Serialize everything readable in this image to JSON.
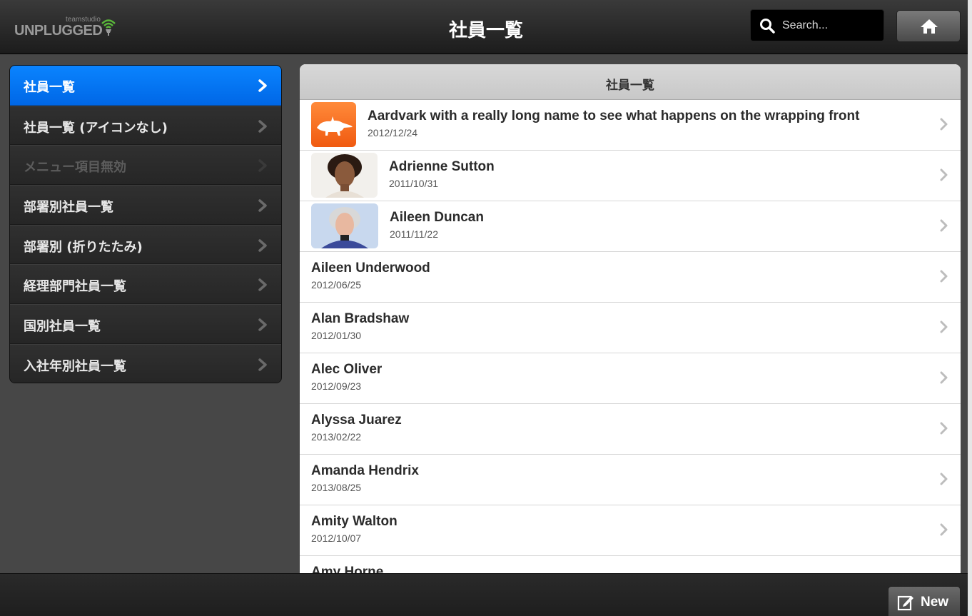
{
  "header": {
    "logo_small": "teamstudio",
    "logo_main": "UNPLUGGED",
    "title": "社員一覧",
    "search_placeholder": "Search..."
  },
  "sidebar": {
    "items": [
      {
        "label": "社員一覧",
        "state": "active"
      },
      {
        "label": "社員一覧 (アイコンなし)",
        "state": "normal"
      },
      {
        "label": "メニュー項目無効",
        "state": "disabled"
      },
      {
        "label": "部署別社員一覧",
        "state": "normal"
      },
      {
        "label": "部署別 (折りたたみ)",
        "state": "normal"
      },
      {
        "label": "経理部門社員一覧",
        "state": "normal"
      },
      {
        "label": "国別社員一覧",
        "state": "normal"
      },
      {
        "label": "入社年別社員一覧",
        "state": "normal"
      }
    ]
  },
  "list": {
    "heading": "社員一覧",
    "rows": [
      {
        "name": "Aardvark with a really long name to see what happens on the wrapping front",
        "date": "2012/12/24",
        "thumb": "aardvark-icon"
      },
      {
        "name": "Adrienne Sutton",
        "date": "2011/10/31",
        "thumb": "portrait-photo"
      },
      {
        "name": "Aileen Duncan",
        "date": "2011/11/22",
        "thumb": "portrait-photo"
      },
      {
        "name": "Aileen Underwood",
        "date": "2012/06/25"
      },
      {
        "name": "Alan Bradshaw",
        "date": "2012/01/30"
      },
      {
        "name": "Alec Oliver",
        "date": "2012/09/23"
      },
      {
        "name": "Alyssa Juarez",
        "date": "2013/02/22"
      },
      {
        "name": "Amanda Hendrix",
        "date": "2013/08/25"
      },
      {
        "name": "Amity Walton",
        "date": "2012/10/07"
      },
      {
        "name": "Amy Horne",
        "date": ""
      }
    ]
  },
  "footer": {
    "new_label": "New"
  },
  "colors": {
    "accent": "#0a84ff",
    "logo_green": "#5ab83a"
  }
}
